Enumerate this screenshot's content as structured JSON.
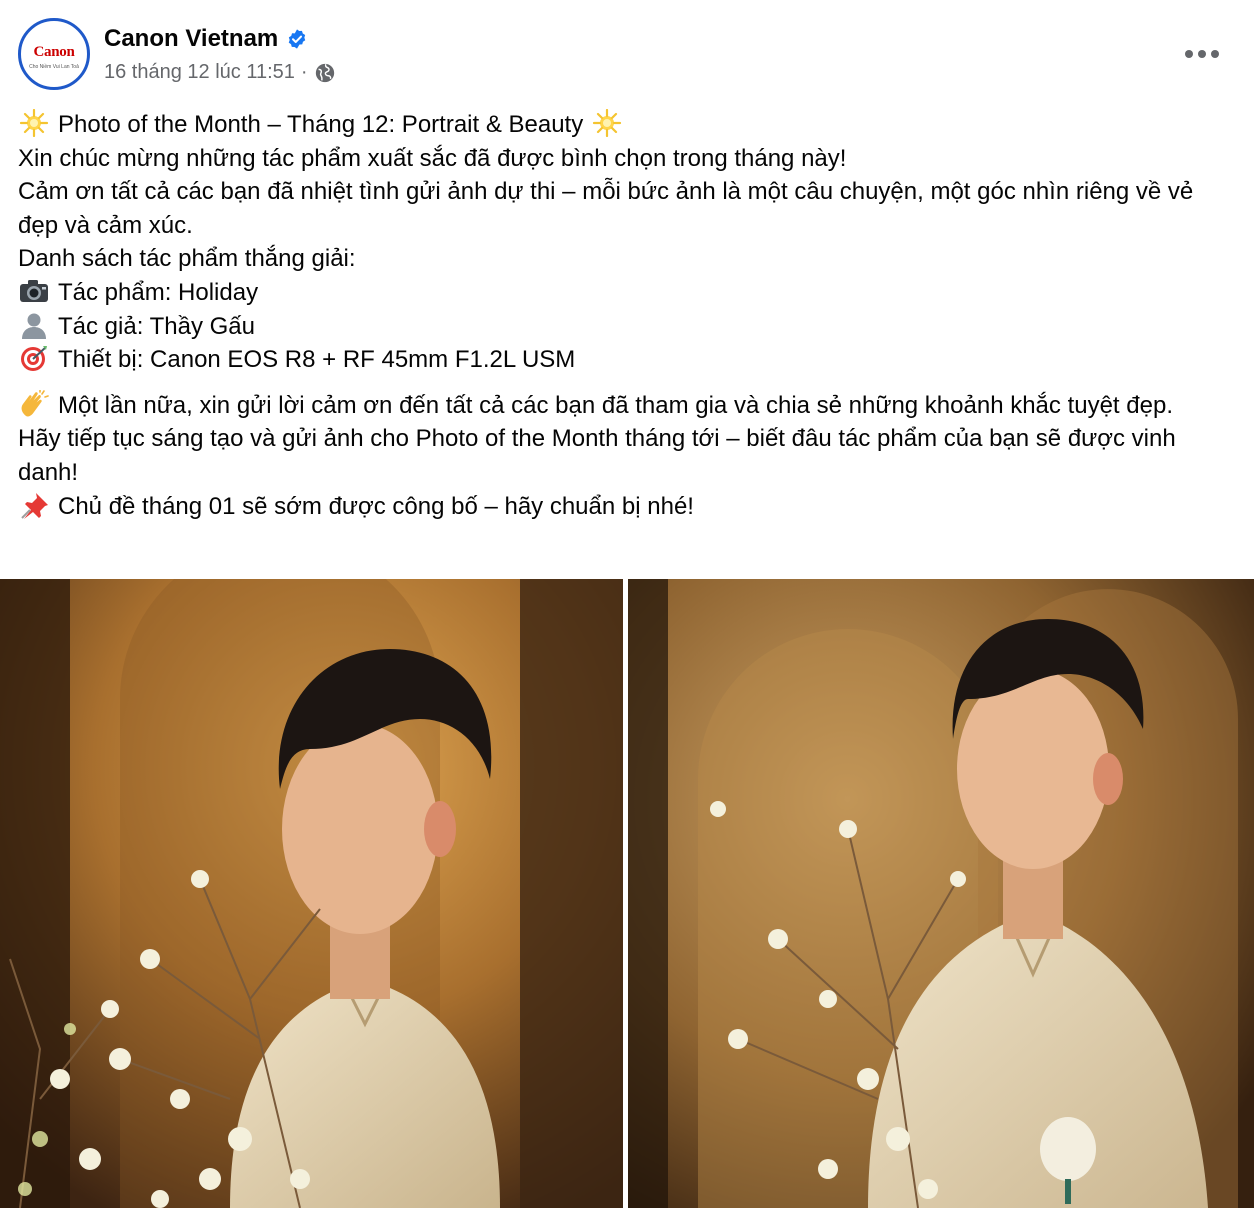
{
  "page": {
    "name": "Canon Vietnam",
    "verified": true,
    "avatar": {
      "logo": "Canon",
      "tagline": "Cho Niềm Vui Lan Toả"
    },
    "timestamp": "16 tháng 12 lúc 11:51",
    "audience_icon": "globe-icon",
    "more_icon": "more-options-icon"
  },
  "post": {
    "lines": [
      {
        "emoji": "sparkle-star-emoji",
        "text": "Photo of the Month – Tháng 12: Portrait & Beauty",
        "trailing_emoji": "sparkle-star-emoji"
      },
      {
        "text": "Xin chúc mừng những tác phẩm xuất sắc đã được bình chọn trong tháng này!"
      },
      {
        "text": "Cảm ơn tất cả các bạn đã nhiệt tình gửi ảnh dự thi – mỗi bức ảnh là một câu chuyện, một góc nhìn riêng về vẻ đẹp và cảm xúc."
      },
      {
        "text": "Danh sách tác phẩm thắng giải:"
      },
      {
        "emoji": "camera-emoji",
        "text": "Tác phẩm: Holiday"
      },
      {
        "emoji": "person-silhouette-emoji",
        "text": "Tác giả: Thầy Gấu"
      },
      {
        "emoji": "direct-hit-emoji",
        "text": "Thiết bị: Canon EOS R8 + RF 45mm F1.2L USM"
      },
      {
        "emoji": "clapping-hands-emoji",
        "text": "Một lần nữa, xin gửi lời cảm ơn đến tất cả các bạn đã tham gia và chia sẻ những khoảnh khắc tuyệt đẹp."
      },
      {
        "text": "Hãy tiếp tục sáng tạo và gửi ảnh cho Photo of the Month tháng tới – biết đâu tác phẩm của bạn sẽ được vinh danh!"
      },
      {
        "emoji": "pushpin-emoji",
        "text": "Chủ đề tháng 01 sẽ sớm được công bố – hãy chuẩn bị nhé!"
      }
    ]
  },
  "photos": [
    {
      "name": "portrait-photo-1",
      "description_icon": "photo"
    },
    {
      "name": "portrait-photo-2",
      "description_icon": "photo"
    }
  ],
  "colors": {
    "text": "#050505",
    "secondary_text": "#65676b",
    "verified_blue": "#1877f2",
    "canon_red": "#cc0000",
    "avatar_ring": "#1f59c9"
  }
}
